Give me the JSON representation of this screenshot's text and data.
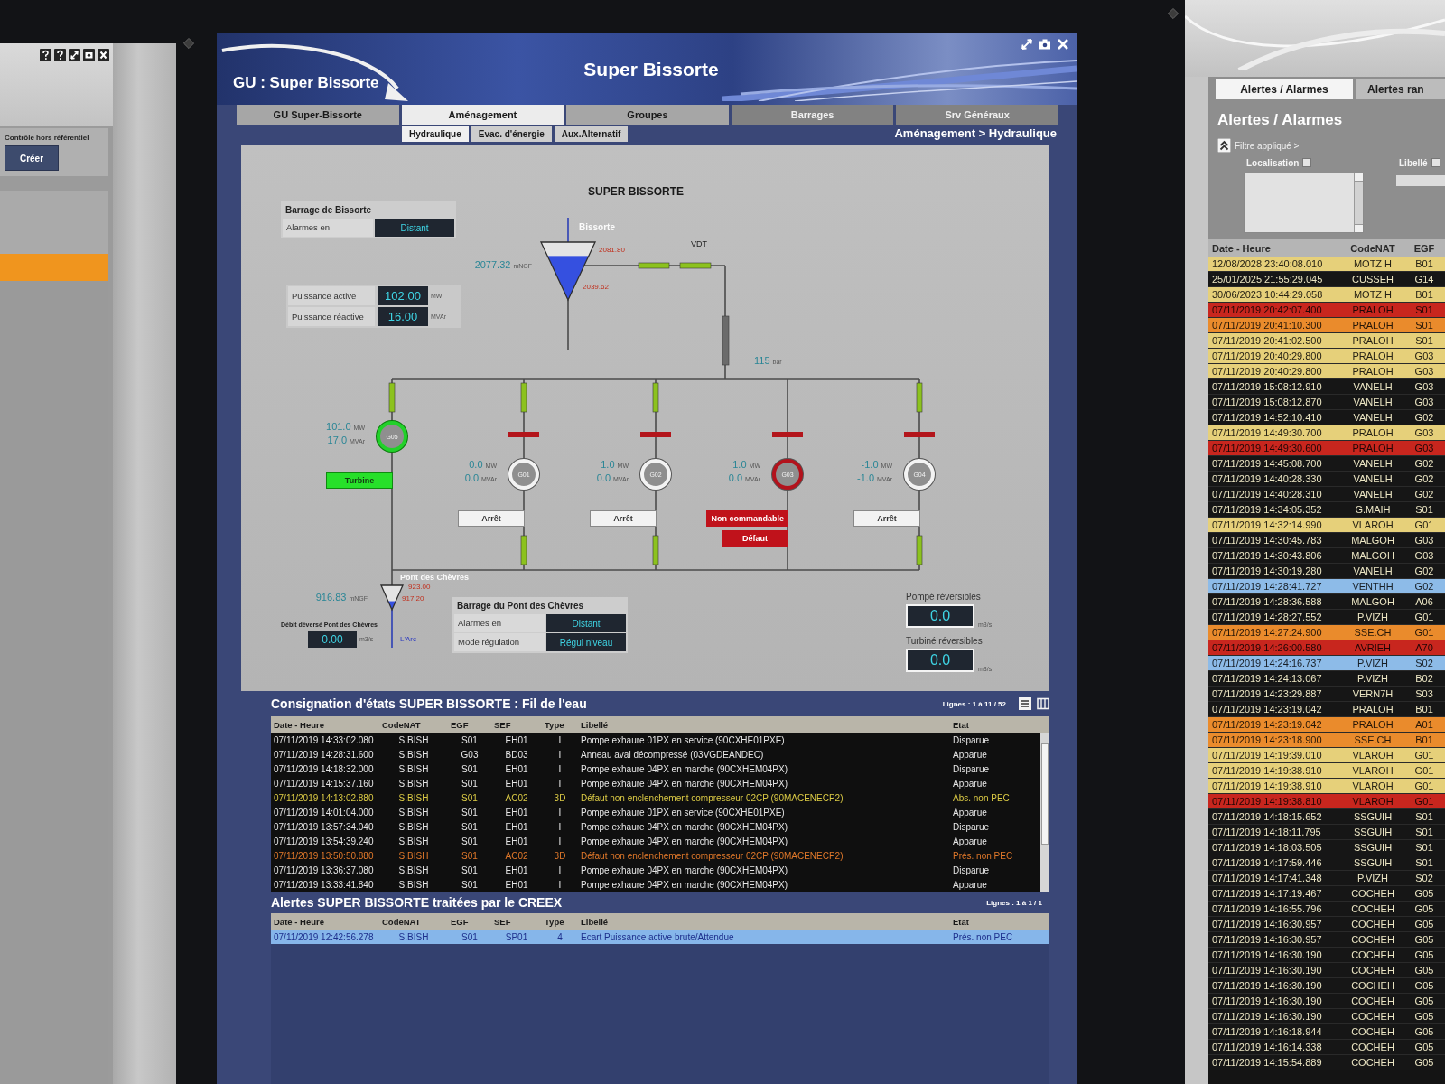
{
  "left_window": {
    "section_label": "Contrôle hors référentiel",
    "create_button": "Créer",
    "list_rows": [
      {
        "selected": true
      }
    ]
  },
  "main_window": {
    "app_title": "GU : Super Bissorte",
    "title": "Super Bissorte",
    "tabs": [
      {
        "label": "GU Super-Bissorte",
        "selected": false,
        "disabled": false
      },
      {
        "label": "Aménagement",
        "selected": true,
        "disabled": false
      },
      {
        "label": "Groupes",
        "selected": false,
        "disabled": false
      },
      {
        "label": "Barrages",
        "selected": false,
        "disabled": true
      },
      {
        "label": "Srv Généraux",
        "selected": false,
        "disabled": true
      }
    ],
    "subtabs": [
      {
        "label": "Hydraulique",
        "selected": true
      },
      {
        "label": "Evac. d'énergie",
        "selected": false
      },
      {
        "label": "Aux.Alternatif",
        "selected": false
      }
    ],
    "breadcrumb": "Aménagement > Hydraulique",
    "synoptic": {
      "title": "SUPER BISSORTE",
      "dam_panels": [
        {
          "title": "Barrage de Bissorte",
          "rows": [
            {
              "label": "Alarmes en",
              "value": "Distant"
            }
          ]
        },
        {
          "title": "Barrage du Pont des Chèvres",
          "rows": [
            {
              "label": "Alarmes en",
              "value": "Distant"
            },
            {
              "label": "Mode régulation",
              "value": "Régul niveau"
            }
          ]
        }
      ],
      "power": [
        {
          "label": "Puissance active",
          "value": "102.00",
          "unit": "MW"
        },
        {
          "label": "Puissance réactive",
          "value": "16.00",
          "unit": "MVAr"
        }
      ],
      "reservoirs": [
        {
          "name": "Bissorte",
          "level": 0.76,
          "elevation": "2077.32",
          "unit": "mNGF",
          "high": "2081.80",
          "low": "2039.62"
        },
        {
          "name": "Pont des Chèvres",
          "level": 0.35,
          "elevation": "916.83",
          "unit": "mNGF",
          "high": "923.00",
          "low": "917.20",
          "outlet": "L'Arc"
        }
      ],
      "penstock": {
        "label": "VDT",
        "valves": [
          {
            "open": true
          },
          {
            "open": true
          }
        ],
        "shaft_valve": {
          "open": false
        },
        "pressure": "115",
        "pressure_unit": "bar"
      },
      "units": [
        {
          "name": "G05",
          "running": true,
          "fault": false,
          "active_power": "101.0",
          "active_unit": "MW",
          "reactive_power": "17.0",
          "reactive_unit": "MVAr",
          "upper_valve": true,
          "breaker": false,
          "lower_valve": false,
          "status": [
            {
              "label": "Turbine",
              "kind": "running"
            }
          ]
        },
        {
          "name": "G01",
          "running": false,
          "fault": false,
          "active_power": "0.0",
          "active_unit": "MW",
          "reactive_power": "0.0",
          "reactive_unit": "MVAr",
          "upper_valve": true,
          "breaker": true,
          "lower_valve": true,
          "status": [
            {
              "label": "Arrêt",
              "kind": "stopped"
            }
          ]
        },
        {
          "name": "G02",
          "running": false,
          "fault": false,
          "active_power": "1.0",
          "active_unit": "MW",
          "reactive_power": "0.0",
          "reactive_unit": "MVAr",
          "upper_valve": true,
          "breaker": true,
          "lower_valve": true,
          "status": [
            {
              "label": "Arrêt",
              "kind": "stopped"
            }
          ]
        },
        {
          "name": "G03",
          "running": false,
          "fault": true,
          "active_power": "1.0",
          "active_unit": "MW",
          "reactive_power": "0.0",
          "reactive_unit": "MVAr",
          "upper_valve": false,
          "breaker": true,
          "lower_valve": false,
          "status": [
            {
              "label": "Non commandable",
              "kind": "fault"
            },
            {
              "label": "Défaut",
              "kind": "fault"
            }
          ]
        },
        {
          "name": "G04",
          "running": false,
          "fault": false,
          "active_power": "-1.0",
          "active_unit": "MW",
          "reactive_power": "-1.0",
          "reactive_unit": "MVAr",
          "upper_valve": true,
          "breaker": true,
          "lower_valve": true,
          "status": [
            {
              "label": "Arrêt",
              "kind": "stopped"
            }
          ]
        }
      ],
      "spill_flow": {
        "label": "Débit déversé Pont des Chèvres",
        "value": "0.00",
        "unit": "m3/s"
      },
      "reversible_flows": [
        {
          "label": "Pompé réversibles",
          "value": "0.0",
          "unit": "m3/s"
        },
        {
          "label": "Turbiné réversibles",
          "value": "0.0",
          "unit": "m3/s"
        }
      ]
    },
    "state_log": {
      "title": "Consignation d'états SUPER BISSORTE : Fil de l'eau",
      "lines": "Lignes : 1 à 11 / 52",
      "columns": [
        "Date - Heure",
        "CodeNAT",
        "EGF",
        "SEF",
        "Type",
        "Libellé",
        "Etat"
      ],
      "rows": [
        {
          "date": "07/11/2019 14:33:02.080",
          "code": "S.BISH",
          "egf": "S01",
          "sef": "EH01",
          "type": "I",
          "label": "Pompe exhaure 01PX en service (90CXHE01PXE)",
          "etat": "Disparue",
          "color": "#e6e6e6"
        },
        {
          "date": "07/11/2019 14:28:31.600",
          "code": "S.BISH",
          "egf": "G03",
          "sef": "BD03",
          "type": "I",
          "label": "Anneau aval décompressé (03VGDEANDEC)",
          "etat": "Apparue",
          "color": "#e6e6e6"
        },
        {
          "date": "07/11/2019 14:18:32.000",
          "code": "S.BISH",
          "egf": "S01",
          "sef": "EH01",
          "type": "I",
          "label": "Pompe exhaure 04PX en marche (90CXHEM04PX)",
          "etat": "Disparue",
          "color": "#e6e6e6"
        },
        {
          "date": "07/11/2019 14:15:37.160",
          "code": "S.BISH",
          "egf": "S01",
          "sef": "EH01",
          "type": "I",
          "label": "Pompe exhaure 04PX en marche (90CXHEM04PX)",
          "etat": "Apparue",
          "color": "#e6e6e6"
        },
        {
          "date": "07/11/2019 14:13:02.880",
          "code": "S.BISH",
          "egf": "S01",
          "sef": "AC02",
          "type": "3D",
          "label": "Défaut non enclenchement compresseur 02CP (90MACENECP2)",
          "etat": "Abs. non PEC",
          "color": "#dccb45"
        },
        {
          "date": "07/11/2019 14:01:04.000",
          "code": "S.BISH",
          "egf": "S01",
          "sef": "EH01",
          "type": "I",
          "label": "Pompe exhaure 01PX en service (90CXHE01PXE)",
          "etat": "Apparue",
          "color": "#e6e6e6"
        },
        {
          "date": "07/11/2019 13:57:34.040",
          "code": "S.BISH",
          "egf": "S01",
          "sef": "EH01",
          "type": "I",
          "label": "Pompe exhaure 04PX en marche (90CXHEM04PX)",
          "etat": "Disparue",
          "color": "#e6e6e6"
        },
        {
          "date": "07/11/2019 13:54:39.240",
          "code": "S.BISH",
          "egf": "S01",
          "sef": "EH01",
          "type": "I",
          "label": "Pompe exhaure 04PX en marche (90CXHEM04PX)",
          "etat": "Apparue",
          "color": "#e6e6e6"
        },
        {
          "date": "07/11/2019 13:50:50.880",
          "code": "S.BISH",
          "egf": "S01",
          "sef": "AC02",
          "type": "3D",
          "label": "Défaut non enclenchement compresseur 02CP (90MACENECP2)",
          "etat": "Prés. non PEC",
          "color": "#e0782a"
        },
        {
          "date": "07/11/2019 13:36:37.080",
          "code": "S.BISH",
          "egf": "S01",
          "sef": "EH01",
          "type": "I",
          "label": "Pompe exhaure 04PX en marche (90CXHEM04PX)",
          "etat": "Disparue",
          "color": "#e6e6e6"
        },
        {
          "date": "07/11/2019 13:33:41.840",
          "code": "S.BISH",
          "egf": "S01",
          "sef": "EH01",
          "type": "I",
          "label": "Pompe exhaure 04PX en marche (90CXHEM04PX)",
          "etat": "Apparue",
          "color": "#e6e6e6"
        }
      ]
    },
    "creex_alerts": {
      "title": "Alertes SUPER BISSORTE traitées par le CREEX",
      "lines": "Lignes : 1 à 1 / 1",
      "columns": [
        "Date - Heure",
        "CodeNAT",
        "EGF",
        "SEF",
        "Type",
        "Libellé",
        "Etat"
      ],
      "rows": [
        {
          "date": "07/11/2019 12:42:56.278",
          "code": "S.BISH",
          "egf": "S01",
          "sef": "SP01",
          "type": "4",
          "label": "Ecart Puissance active brute/Attendue",
          "etat": "Prés. non PEC",
          "selected": true
        }
      ]
    }
  },
  "alarm_window": {
    "tabs": [
      {
        "label": "Alertes / Alarmes",
        "selected": true
      },
      {
        "label": "Alertes ran",
        "selected": false
      }
    ],
    "title": "Alertes / Alarmes",
    "filter": {
      "label": "Filtre appliqué >",
      "expanded": true,
      "fields": [
        {
          "label": "Localisation",
          "checked": false,
          "kind": "list"
        },
        {
          "label": "Libellé",
          "checked": false,
          "kind": "text"
        }
      ]
    },
    "columns": [
      "Date - Heure",
      "CodeNAT",
      "EGF"
    ],
    "rows": [
      {
        "date": "12/08/2028 23:40:08.010",
        "code": "MOTZ H",
        "egf": "B01",
        "color": "#e6d07a"
      },
      {
        "date": "25/01/2025 21:55:29.045",
        "code": "CUSSEH",
        "egf": "G14",
        "color": "#161616"
      },
      {
        "date": "30/06/2023 10:44:29.058",
        "code": "MOTZ H",
        "egf": "B01",
        "color": "#e6d07a"
      },
      {
        "date": "07/11/2019 20:42:07.400",
        "code": "PRALOH",
        "egf": "S01",
        "color": "#c8261e"
      },
      {
        "date": "07/11/2019 20:41:10.300",
        "code": "PRALOH",
        "egf": "S01",
        "color": "#ea8b2c"
      },
      {
        "date": "07/11/2019 20:41:02.500",
        "code": "PRALOH",
        "egf": "S01",
        "color": "#e6d07a"
      },
      {
        "date": "07/11/2019 20:40:29.800",
        "code": "PRALOH",
        "egf": "G03",
        "color": "#e6d07a"
      },
      {
        "date": "07/11/2019 20:40:29.800",
        "code": "PRALOH",
        "egf": "G03",
        "color": "#e6d07a"
      },
      {
        "date": "07/11/2019 15:08:12.910",
        "code": "VANELH",
        "egf": "G03",
        "color": "#161616"
      },
      {
        "date": "07/11/2019 15:08:12.870",
        "code": "VANELH",
        "egf": "G03",
        "color": "#161616"
      },
      {
        "date": "07/11/2019 14:52:10.410",
        "code": "VANELH",
        "egf": "G02",
        "color": "#161616"
      },
      {
        "date": "07/11/2019 14:49:30.700",
        "code": "PRALOH",
        "egf": "G03",
        "color": "#e6d07a"
      },
      {
        "date": "07/11/2019 14:49:30.600",
        "code": "PRALOH",
        "egf": "G03",
        "color": "#c8261e"
      },
      {
        "date": "07/11/2019 14:45:08.700",
        "code": "VANELH",
        "egf": "G02",
        "color": "#161616"
      },
      {
        "date": "07/11/2019 14:40:28.330",
        "code": "VANELH",
        "egf": "G02",
        "color": "#161616"
      },
      {
        "date": "07/11/2019 14:40:28.310",
        "code": "VANELH",
        "egf": "G02",
        "color": "#161616"
      },
      {
        "date": "07/11/2019 14:34:05.352",
        "code": "G.MAIH",
        "egf": "S01",
        "color": "#161616"
      },
      {
        "date": "07/11/2019 14:32:14.990",
        "code": "VLAROH",
        "egf": "G01",
        "color": "#e6d07a"
      },
      {
        "date": "07/11/2019 14:30:45.783",
        "code": "MALGOH",
        "egf": "G03",
        "color": "#161616"
      },
      {
        "date": "07/11/2019 14:30:43.806",
        "code": "MALGOH",
        "egf": "G03",
        "color": "#161616"
      },
      {
        "date": "07/11/2019 14:30:19.280",
        "code": "VANELH",
        "egf": "G02",
        "color": "#161616"
      },
      {
        "date": "07/11/2019 14:28:41.727",
        "code": "VENTHH",
        "egf": "G02",
        "color": "#8dbbe8"
      },
      {
        "date": "07/11/2019 14:28:36.588",
        "code": "MALGOH",
        "egf": "A06",
        "color": "#161616"
      },
      {
        "date": "07/11/2019 14:28:27.552",
        "code": "P.VIZH",
        "egf": "G01",
        "color": "#161616"
      },
      {
        "date": "07/11/2019 14:27:24.900",
        "code": "SSE.CH",
        "egf": "G01",
        "color": "#ea8b2c"
      },
      {
        "date": "07/11/2019 14:26:00.580",
        "code": "AVRIEH",
        "egf": "A70",
        "color": "#c8261e"
      },
      {
        "date": "07/11/2019 14:24:16.737",
        "code": "P.VIZH",
        "egf": "S02",
        "color": "#8dbbe8"
      },
      {
        "date": "07/11/2019 14:24:13.067",
        "code": "P.VIZH",
        "egf": "B02",
        "color": "#161616"
      },
      {
        "date": "07/11/2019 14:23:29.887",
        "code": "VERN7H",
        "egf": "S03",
        "color": "#161616"
      },
      {
        "date": "07/11/2019 14:23:19.042",
        "code": "PRALOH",
        "egf": "B01",
        "color": "#161616"
      },
      {
        "date": "07/11/2019 14:23:19.042",
        "code": "PRALOH",
        "egf": "A01",
        "color": "#ea8b2c"
      },
      {
        "date": "07/11/2019 14:23:18.900",
        "code": "SSE.CH",
        "egf": "B01",
        "color": "#ea8b2c"
      },
      {
        "date": "07/11/2019 14:19:39.010",
        "code": "VLAROH",
        "egf": "G01",
        "color": "#e6d07a"
      },
      {
        "date": "07/11/2019 14:19:38.910",
        "code": "VLAROH",
        "egf": "G01",
        "color": "#e6d07a"
      },
      {
        "date": "07/11/2019 14:19:38.910",
        "code": "VLAROH",
        "egf": "G01",
        "color": "#e6d07a"
      },
      {
        "date": "07/11/2019 14:19:38.810",
        "code": "VLAROH",
        "egf": "G01",
        "color": "#c8261e"
      },
      {
        "date": "07/11/2019 14:18:15.652",
        "code": "SSGUIH",
        "egf": "S01",
        "color": "#161616"
      },
      {
        "date": "07/11/2019 14:18:11.795",
        "code": "SSGUIH",
        "egf": "S01",
        "color": "#161616"
      },
      {
        "date": "07/11/2019 14:18:03.505",
        "code": "SSGUIH",
        "egf": "S01",
        "color": "#161616"
      },
      {
        "date": "07/11/2019 14:17:59.446",
        "code": "SSGUIH",
        "egf": "S01",
        "color": "#161616"
      },
      {
        "date": "07/11/2019 14:17:41.348",
        "code": "P.VIZH",
        "egf": "S02",
        "color": "#161616"
      },
      {
        "date": "07/11/2019 14:17:19.467",
        "code": "COCHEH",
        "egf": "G05",
        "color": "#161616"
      },
      {
        "date": "07/11/2019 14:16:55.796",
        "code": "COCHEH",
        "egf": "G05",
        "color": "#161616"
      },
      {
        "date": "07/11/2019 14:16:30.957",
        "code": "COCHEH",
        "egf": "G05",
        "color": "#161616"
      },
      {
        "date": "07/11/2019 14:16:30.957",
        "code": "COCHEH",
        "egf": "G05",
        "color": "#161616"
      },
      {
        "date": "07/11/2019 14:16:30.190",
        "code": "COCHEH",
        "egf": "G05",
        "color": "#161616"
      },
      {
        "date": "07/11/2019 14:16:30.190",
        "code": "COCHEH",
        "egf": "G05",
        "color": "#161616"
      },
      {
        "date": "07/11/2019 14:16:30.190",
        "code": "COCHEH",
        "egf": "G05",
        "color": "#161616"
      },
      {
        "date": "07/11/2019 14:16:30.190",
        "code": "COCHEH",
        "egf": "G05",
        "color": "#161616"
      },
      {
        "date": "07/11/2019 14:16:30.190",
        "code": "COCHEH",
        "egf": "G05",
        "color": "#161616"
      },
      {
        "date": "07/11/2019 14:16:18.944",
        "code": "COCHEH",
        "egf": "G05",
        "color": "#161616"
      },
      {
        "date": "07/11/2019 14:16:14.338",
        "code": "COCHEH",
        "egf": "G05",
        "color": "#161616"
      },
      {
        "date": "07/11/2019 14:15:54.889",
        "code": "COCHEH",
        "egf": "G05",
        "color": "#161616"
      }
    ]
  }
}
